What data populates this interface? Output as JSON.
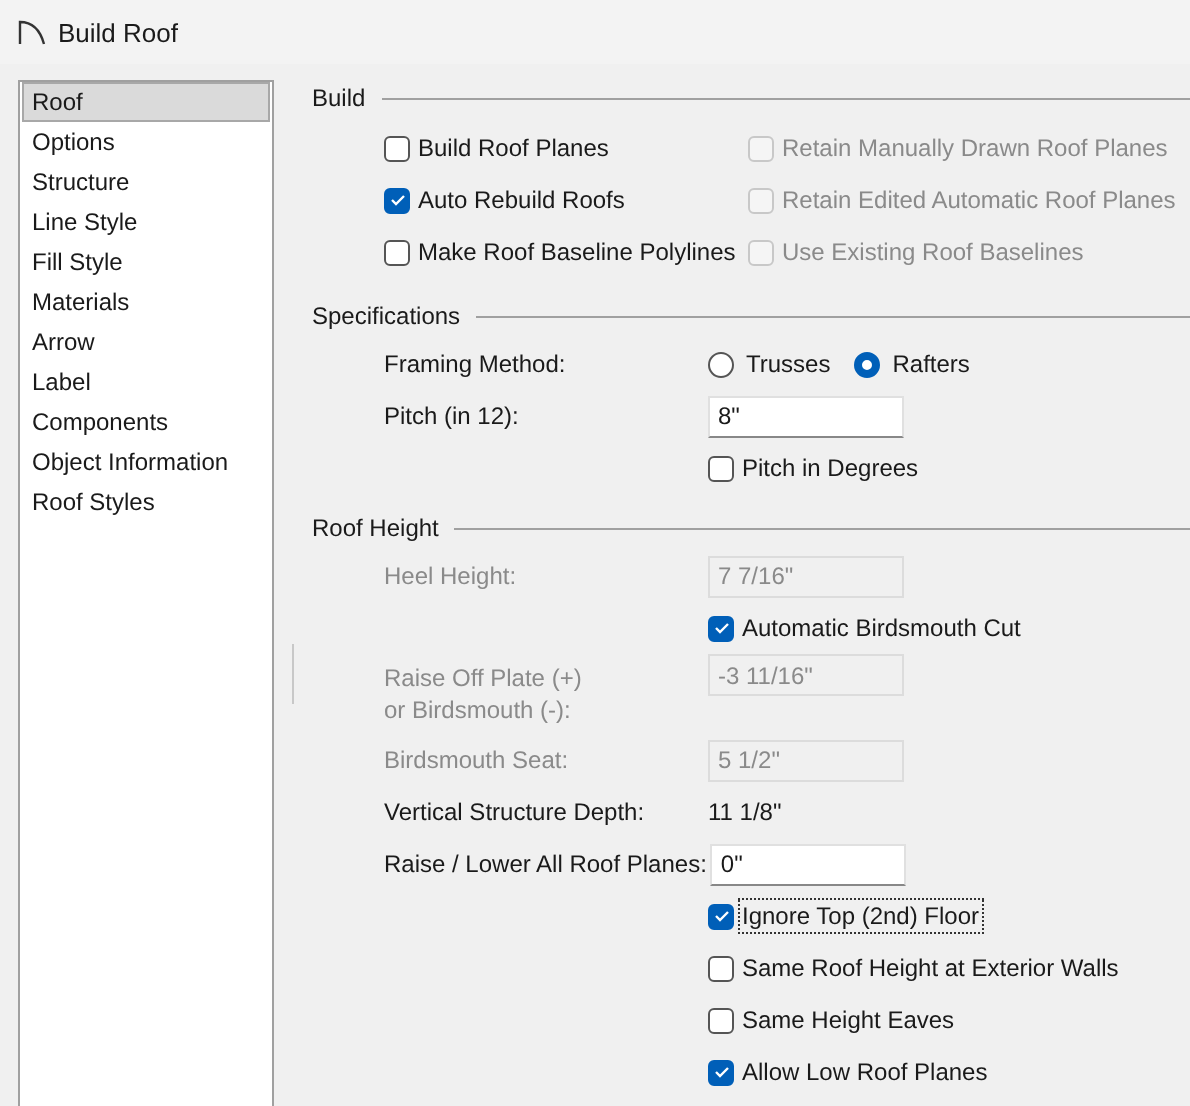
{
  "window": {
    "title": "Build Roof"
  },
  "sidebar": {
    "items": [
      {
        "label": "Roof",
        "selected": true
      },
      {
        "label": "Options",
        "selected": false
      },
      {
        "label": "Structure",
        "selected": false
      },
      {
        "label": "Line Style",
        "selected": false
      },
      {
        "label": "Fill Style",
        "selected": false
      },
      {
        "label": "Materials",
        "selected": false
      },
      {
        "label": "Arrow",
        "selected": false
      },
      {
        "label": "Label",
        "selected": false
      },
      {
        "label": "Components",
        "selected": false
      },
      {
        "label": "Object Information",
        "selected": false
      },
      {
        "label": "Roof Styles",
        "selected": false
      }
    ]
  },
  "build": {
    "title": "Build",
    "options": [
      {
        "label": "Build Roof Planes",
        "checked": false,
        "disabled": false
      },
      {
        "label": "Retain Manually Drawn Roof Planes",
        "checked": false,
        "disabled": true
      },
      {
        "label": "Auto Rebuild Roofs",
        "checked": true,
        "disabled": false
      },
      {
        "label": "Retain Edited Automatic Roof Planes",
        "checked": false,
        "disabled": true
      },
      {
        "label": "Make Roof Baseline Polylines",
        "checked": false,
        "disabled": false
      },
      {
        "label": "Use Existing Roof Baselines",
        "checked": false,
        "disabled": true
      }
    ]
  },
  "specifications": {
    "title": "Specifications",
    "rows": [
      {
        "kind": "radio",
        "label": "Framing Method:",
        "options": [
          {
            "label": "Trusses",
            "selected": false
          },
          {
            "label": "Rafters",
            "selected": true
          }
        ]
      },
      {
        "kind": "field",
        "label": "Pitch (in 12):",
        "value": "8\"",
        "disabled": false
      },
      {
        "kind": "checkbox",
        "label": "Pitch in Degrees",
        "checked": false,
        "disabled": false,
        "focused": false
      }
    ]
  },
  "roof_height": {
    "title": "Roof Height",
    "rows": [
      {
        "kind": "field",
        "label": "Heel Height:",
        "value": "7 7/16\"",
        "disabled": true
      },
      {
        "kind": "checkbox",
        "label": "Automatic Birdsmouth Cut",
        "checked": true,
        "disabled": false,
        "focused": false
      },
      {
        "kind": "field",
        "label": "Raise Off Plate (+)\nor Birdsmouth (-):",
        "value": "-3 11/16\"",
        "disabled": true
      },
      {
        "kind": "field",
        "label": "Birdsmouth Seat:",
        "value": "5 1/2\"",
        "disabled": true
      },
      {
        "kind": "value",
        "label": "Vertical Structure Depth:",
        "value": "11 1/8\""
      },
      {
        "kind": "field",
        "label": "Raise / Lower All Roof Planes:",
        "value": "0\"",
        "disabled": false
      },
      {
        "kind": "checkbox",
        "label": "Ignore Top (2nd) Floor",
        "checked": true,
        "disabled": false,
        "focused": true
      },
      {
        "kind": "checkbox",
        "label": "Same Roof Height at Exterior Walls",
        "checked": false,
        "disabled": false,
        "focused": false
      },
      {
        "kind": "checkbox",
        "label": "Same Height Eaves",
        "checked": false,
        "disabled": false,
        "focused": false
      },
      {
        "kind": "checkbox",
        "label": "Allow Low Roof Planes",
        "checked": true,
        "disabled": false,
        "focused": false
      }
    ]
  }
}
